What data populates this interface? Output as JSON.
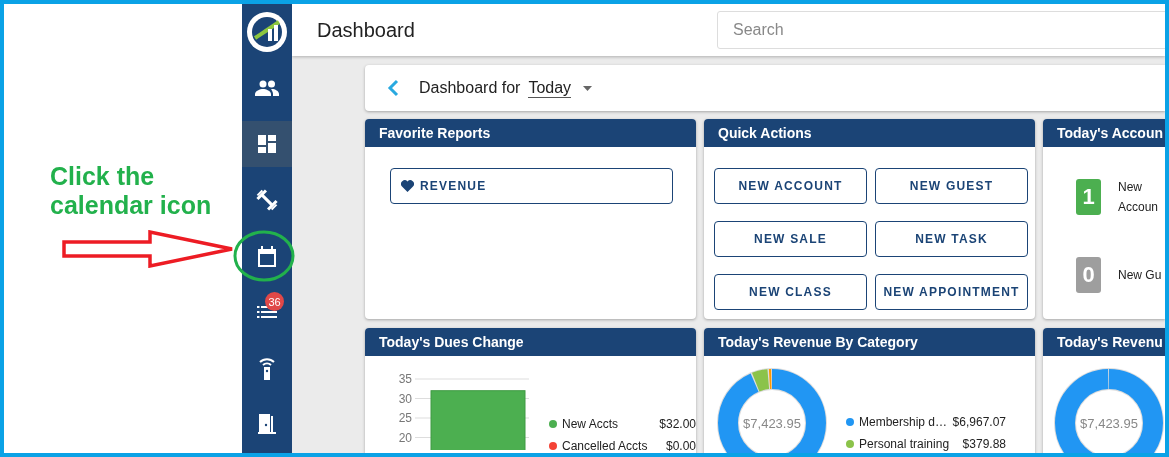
{
  "annotation": {
    "text": "Click the calendar icon"
  },
  "sidebar": {
    "items": [
      {
        "kind": "people",
        "selected": false
      },
      {
        "kind": "dashboard",
        "selected": true
      },
      {
        "kind": "dumbbell",
        "selected": false
      },
      {
        "kind": "calendar",
        "selected": false,
        "highlighted": true
      },
      {
        "kind": "list",
        "selected": false,
        "badge": "36"
      },
      {
        "kind": "remote",
        "selected": false
      },
      {
        "kind": "door",
        "selected": false
      }
    ]
  },
  "header": {
    "title": "Dashboard",
    "search": {
      "placeholder": "Search"
    }
  },
  "period_bar": {
    "label": "Dashboard for",
    "period": "Today"
  },
  "favorite_reports": {
    "title": "Favorite Reports",
    "items": [
      "REVENUE"
    ]
  },
  "quick_actions": {
    "title": "Quick Actions",
    "buttons": [
      "NEW ACCOUNT",
      "NEW GUEST",
      "NEW SALE",
      "NEW TASK",
      "NEW CLASS",
      "NEW APPOINTMENT"
    ]
  },
  "todays_accounts": {
    "title": "Today's Accoun",
    "items": [
      {
        "count": "1",
        "label": "New Accoun",
        "color": "#4caf50"
      },
      {
        "count": "0",
        "label": "New Gu",
        "color": "#9e9e9e"
      }
    ]
  },
  "dues_change": {
    "title": "Today's Dues Change",
    "chart_data": {
      "type": "bar",
      "series": [
        {
          "color": "#4caf50",
          "values": [
            32
          ]
        }
      ],
      "ylim": [
        0,
        35
      ],
      "grid": true,
      "yticks": [
        20,
        25,
        30,
        35
      ]
    },
    "legend": [
      {
        "label": "New Accts",
        "value": "$32.00",
        "color": "#4caf50"
      },
      {
        "label": "Cancelled Accts",
        "value": "$0.00",
        "color": "#f44336"
      }
    ]
  },
  "revenue_by_category": {
    "title": "Today's Revenue By Category",
    "total": "$7,423.95",
    "legend": [
      {
        "label": "Membership d…",
        "value": "$6,967.07",
        "color": "#2196f3"
      },
      {
        "label": "Personal training",
        "value": "$379.88",
        "color": "#8bc34a"
      }
    ]
  },
  "revenue_card": {
    "title": "Today's Revenu",
    "total": "$7,423.95"
  }
}
